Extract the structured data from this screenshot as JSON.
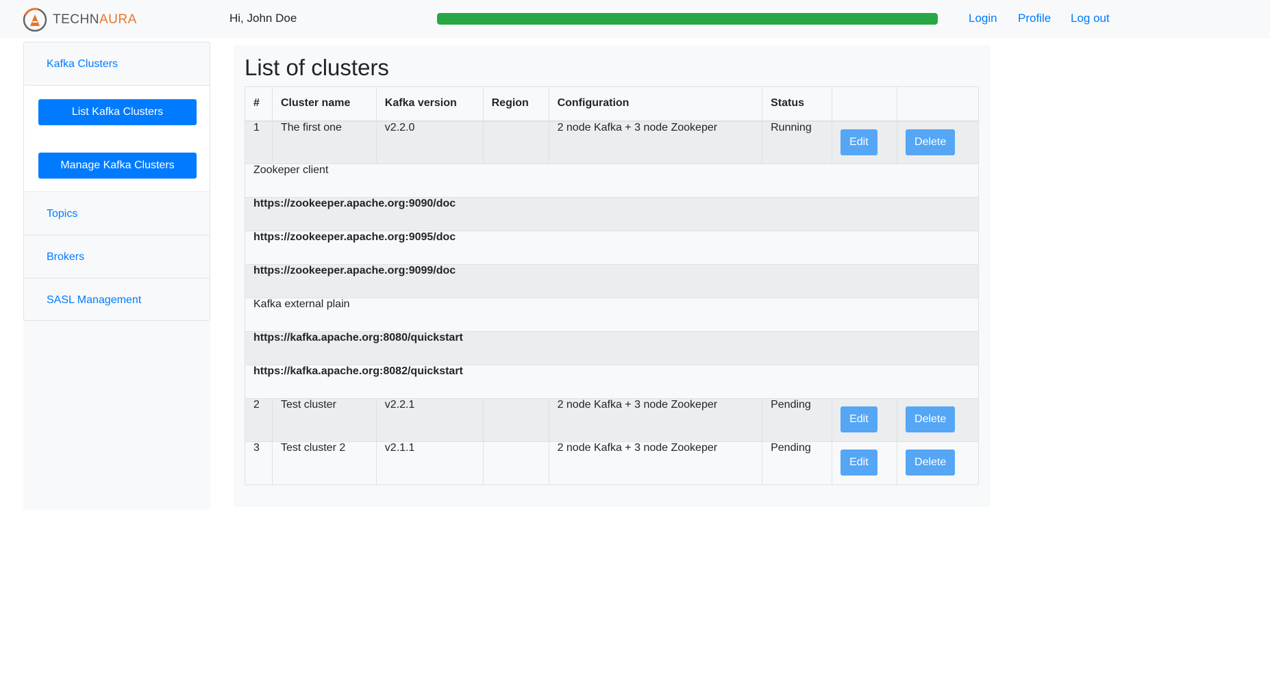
{
  "navbar": {
    "logo": {
      "prefix": "TECHN",
      "accent": "AURA"
    },
    "greeting": "Hi, John Doe",
    "progress_percent": 100,
    "progress_color": "#28a745",
    "links": {
      "login": "Login",
      "profile": "Profile",
      "logout": "Log out"
    }
  },
  "sidebar": {
    "kafka_clusters": "Kafka Clusters",
    "list_button": "List Kafka Clusters",
    "manage_button": "Manage Kafka Clusters",
    "topics": "Topics",
    "brokers": "Brokers",
    "sasl": "SASL Management"
  },
  "main": {
    "title": "List of clusters",
    "columns": [
      "#",
      "Cluster name",
      "Kafka version",
      "Region",
      "Configuration",
      "Status",
      "",
      ""
    ],
    "rows": [
      {
        "num": "1",
        "name": "The first one",
        "version": "v2.2.0",
        "region": "",
        "config": "2 node Kafka + 3 node Zookeper",
        "status": "Running",
        "edit": "Edit",
        "delete": "Delete"
      },
      {
        "num": "2",
        "name": "Test cluster",
        "version": "v2.2.1",
        "region": "",
        "config": "2 node Kafka + 3 node Zookeper",
        "status": "Pending",
        "edit": "Edit",
        "delete": "Delete"
      },
      {
        "num": "3",
        "name": "Test cluster 2",
        "version": "v2.1.1",
        "region": "",
        "config": "2 node Kafka + 3 node Zookeper",
        "status": "Pending",
        "edit": "Edit",
        "delete": "Delete"
      }
    ],
    "details": [
      {
        "text": "Zookeper client",
        "bold": false
      },
      {
        "text": "https://zookeeper.apache.org:9090/doc",
        "bold": true
      },
      {
        "text": "https://zookeeper.apache.org:9095/doc",
        "bold": true
      },
      {
        "text": "https://zookeeper.apache.org:9099/doc",
        "bold": true
      },
      {
        "text": "Kafka external plain",
        "bold": false
      },
      {
        "text": "https://kafka.apache.org:8080/quickstart",
        "bold": true
      },
      {
        "text": "https://kafka.apache.org:8082/quickstart",
        "bold": true
      }
    ]
  },
  "colors": {
    "primary": "#007bff",
    "light_button": "#55a6f5",
    "logo_accent": "#e8752a"
  }
}
